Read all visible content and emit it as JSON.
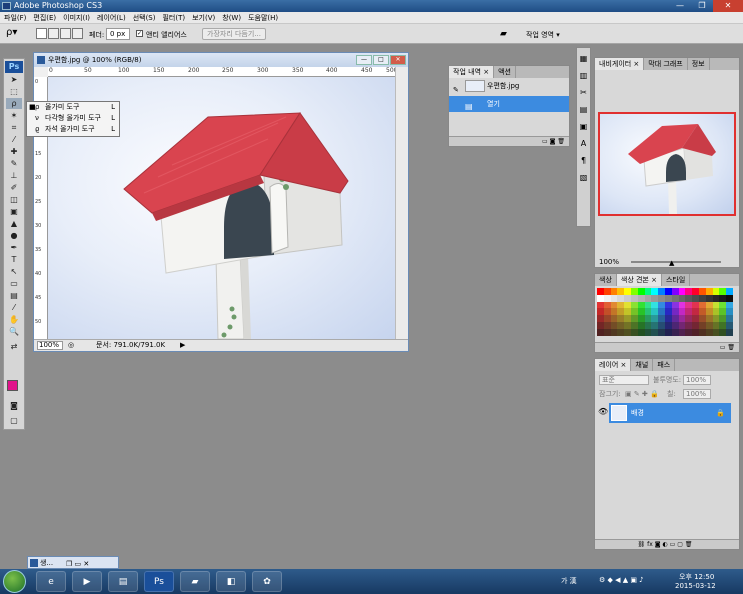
{
  "app": {
    "title": "Adobe Photoshop CS3"
  },
  "menu": [
    "파일(F)",
    "편집(E)",
    "이미지(I)",
    "레이어(L)",
    "선택(S)",
    "필터(T)",
    "보기(V)",
    "창(W)",
    "도움말(H)"
  ],
  "options": {
    "feather_label": "페더:",
    "feather_value": "0 px",
    "antialias_label": "앤티 앨리어스",
    "refine_edge": "가장자리 다듬기...",
    "workspace": "작업 영역 ▾"
  },
  "toolbox": {
    "logo": "Ps"
  },
  "flyout": [
    {
      "label": "올가미 도구",
      "key": "L"
    },
    {
      "label": "다각형 올가미 도구",
      "key": "L"
    },
    {
      "label": "자석 올가미 도구",
      "key": "L"
    }
  ],
  "document": {
    "title": "우편함.jpg @ 100% (RGB/8)",
    "zoom": "100%",
    "doc_size": "문서: 791.0K/791.0K",
    "ruler_ticks": [
      "0",
      "50",
      "100",
      "150",
      "200",
      "250",
      "300",
      "350",
      "400",
      "450",
      "500"
    ],
    "ruler_left": [
      "0",
      "5",
      "10",
      "15",
      "20",
      "25",
      "30",
      "35",
      "40",
      "45",
      "50"
    ]
  },
  "history": {
    "tabs": [
      "작업 내역 ×",
      "액션"
    ],
    "snapshot": "우편함.jpg",
    "step": "열기"
  },
  "navigator": {
    "tabs": [
      "내비게이터 ×",
      "막대 그래프",
      "정보"
    ],
    "zoom": "100%"
  },
  "swatches": {
    "tabs": [
      "색상",
      "색상 견본 ×",
      "스타일"
    ]
  },
  "layers": {
    "tabs": [
      "레이어 ×",
      "채널",
      "패스"
    ],
    "blend_mode": "표준",
    "opacity_label": "불투명도:",
    "opacity_value": "100%",
    "lock_label": "잠그기:",
    "fill_label": "칠:",
    "fill_value": "100%",
    "layer_name": "배경"
  },
  "minidoc": {
    "label": "생..."
  },
  "taskbar": {
    "ime": "가 漢",
    "time": "오후 12:50",
    "date": "2015-03-12"
  }
}
